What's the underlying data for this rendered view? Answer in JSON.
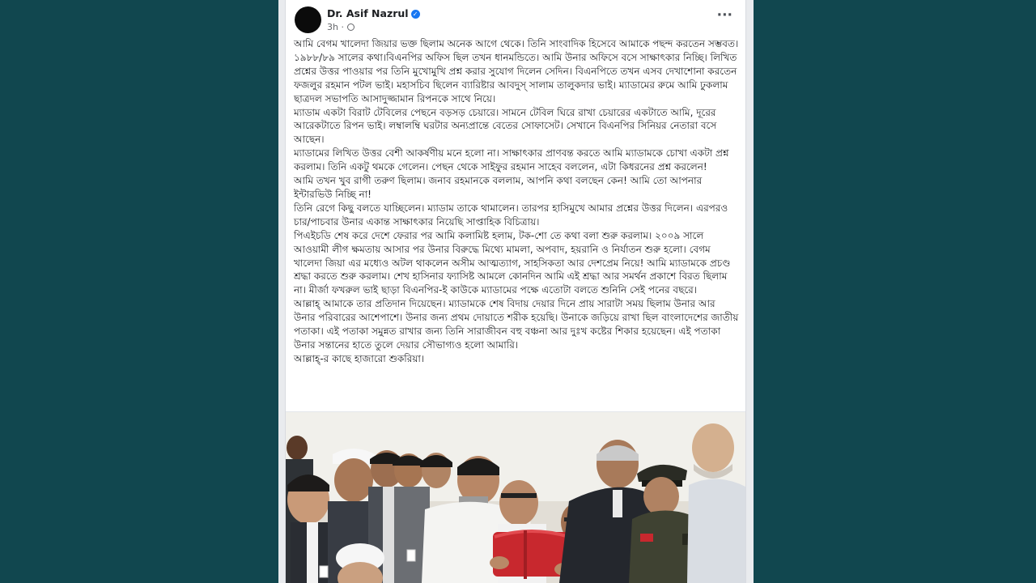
{
  "post": {
    "author": "Dr. Asif Nazrul",
    "time": "3h",
    "separator": "·",
    "more_label": "···",
    "paragraphs": [
      "আমি বেগম খালেদা জিয়ার ভক্ত ছিলাম অনেক আগে থেকে। তিনি সাংবাদিক হিসেবে আমাকে পছন্দ করতেন সম্ভবত। ১৯৮৮/৮৯ সালের কথা।বিএনপির অফিস ছিল তখন ধানমন্ডিতে। আমি উনার অফিসে বসে সাক্ষাৎকার নিচ্ছি। লিখিত প্রশ্নের উত্তর পাওয়ার পর তিনি মুখোমুখি প্রশ্ন করার সুযোগ দিলেন সেদিন। বিএনপিতে তখন এসব দেখাশোনা করতেন ফজলুর রহমান পটল ভাই। মহাসচিব ছিলেন ব্যারিষ্টার আবদুস্ সালাম তালুকদার ভাই। ম্যাডামের রুমে আমি ঢুকলাম ছাত্রদল সভাপতি আসাদুজ্জামান রিপনকে সাথে নিয়ে।",
      "ম্যাডাম একটা বিরাট টেবিলের পেছনে বড়সড় চেয়ারে। সামনে টেবিল ঘিরে রাখা চেয়ারের একটাতে আমি, দূরের আরেকটাতে রিপন ভাই। লম্বালম্বি ঘরটার অন্যপ্রান্তে বেতের সোফাসেট। সেখানে বিএনপির সিনিয়র নেতারা বসে আছেন।",
      "ম্যাডামের লিখিত উত্তর বেশী আকর্ষণীয় মনে হলো না। সাক্ষাৎকার প্রাণবন্ত করতে আমি ম্যাডামকে চোখা একটা প্রশ্ন করলাম। তিনি একটু থমকে গেলেন। পেছন থেকে সাইফুর রহমান সাহেব বললেন, এটা কিধরনের প্রশ্ন করলেন!",
      "আমি তখন খুব রাগী তরুণ ছিলাম। জনাব রহমানকে বললাম, আপনি কথা বলছেন কেন! আমি তো আপনার ইন্টারভিউ নিচ্ছি না!",
      "তিনি রেগে কিছু বলতে যাচ্ছিলেন। ম্যাডাম তাকে থামালেন। তারপর হাসিমুখে আমার প্রশ্নের উত্তর দিলেন। এরপরও চার/পাচবার উনার একান্ত সাক্ষাৎকার নিয়েছি সাপ্তাহিক বিচিত্রায়।",
      "পিএইচডি শেষ করে দেশে ফেরার পর আমি কলামিষ্ট হলাম, টক-শো তে কথা বলা শুরু করলাম। ২০০৯ সালে আওয়ামী লীগ ক্ষমতায় আসার পর উনার বিরুদ্ধে মিথ্যে মামলা, অপবাদ, হয়রানি ও নির্যাতন শুরু হলো। বেগম খালেদা জিয়া এর মধ্যেও অটল থাকলেন অসীম আত্মত্যাগ, সাহসিকতা আর দেশপ্রেম নিয়ে! আমি ম্যাডামকে প্রচণ্ড শ্রদ্ধা করতে শুরু করলাম। শেখ হাসিনার ফ্যাসিষ্ট আমলে কোনদিন আমি এই শ্রদ্ধা আর সমর্থন প্রকাশে বিরত ছিলাম না। মীর্জা ফখরুল ভাই ছাড়া বিএনপির-ই কাউকে ম্যাডামের পক্ষে এতোটা বলতে শুনিনি সেই পনের বছরে।",
      "আল্লাহ্ আমাকে তার প্রতিদান দিয়েছেন। ম্যাডামকে শেষ বিদায় দেয়ার দিনে প্রায় সারাটা সময় ছিলাম উনার আর উনার পরিবারের আশেপাশে।  উনার জন্য প্রথম দোয়াতে শরীক হয়েছি। উনাকে জড়িয়ে রাখা ছিল বাংলাদেশের জাতীয় পতাকা। এই পতাকা সমুন্নত রাখার জন্য তিনি সারাজীবন বহু বঞ্চনা আর দুঃখ কষ্টের শিকার হয়েছেন। এই পতাকা উনার সন্তানের হাতে তুলে দেয়ার সৌভাগ্যও হলো আমারি।",
      "আল্লাহ্-র কাছে হাজারো শুকরিয়া।"
    ]
  },
  "colors": {
    "background": "#11474f",
    "card": "#ffffff",
    "verified": "#1877f2",
    "text": "#1c1e21",
    "meta": "#65676b"
  },
  "icons": {
    "verified": "verified-badge-icon",
    "audience": "globe-icon",
    "more": "more-options-icon"
  }
}
